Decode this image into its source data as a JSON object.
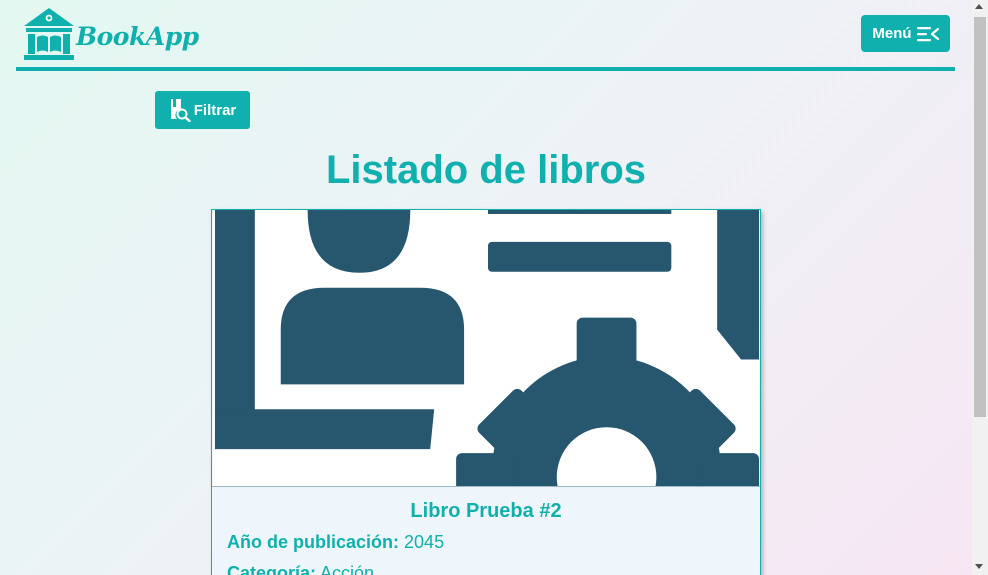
{
  "header": {
    "logo_text": "BookApp",
    "logo_icon": "library-building-icon",
    "menu_label": "Menú",
    "menu_icon": "menu-collapse-icon"
  },
  "toolbar": {
    "filter_label": "Filtrar",
    "filter_icon": "book-search-icon"
  },
  "main": {
    "title": "Listado de libros",
    "books": [
      {
        "title": "Libro Prueba #2",
        "image_icon": "user-settings-icon",
        "year_label": "Año de publicación:",
        "year": "2045",
        "category_label": "Categoría:",
        "category": "Acción"
      }
    ]
  },
  "colors": {
    "accent": "#0fb0ad",
    "image_fg": "#27566f",
    "card_bg": "#eff6fb"
  }
}
